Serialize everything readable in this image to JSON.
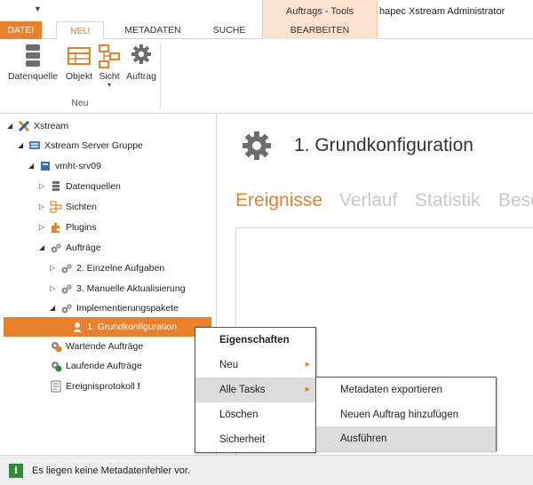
{
  "window": {
    "context_tab_group": "Auftrags - Tools",
    "title": "hapec Xstream Administrator"
  },
  "tabs": {
    "datei": "DATEI",
    "neu": "NEU",
    "metadaten": "METADATEN",
    "suche": "SUCHE",
    "bearbeiten": "BEARBEITEN"
  },
  "ribbon": {
    "buttons": {
      "datenquelle": "Datenquelle",
      "objekt": "Objekt",
      "sicht": "Sicht",
      "auftrag": "Auftrag"
    },
    "group_label": "Neu"
  },
  "tree": {
    "xstream": "Xstream",
    "server_gruppe": "Xstream Server Gruppe",
    "server": "vmht-srv09",
    "datenquellen": "Datenquellen",
    "sichten": "Sichten",
    "plugins": "Plugins",
    "auftraege": "Aufträge",
    "einzelne_aufgaben": "2. Einzelne Aufgaben",
    "manuelle_aktualisierung": "3. Manuelle Aktualisierung",
    "implementierungspakete": "Implementierungspakete",
    "grundkonfiguration": "1. Grundkonfiguration",
    "wartende": "Wartende Aufträge",
    "laufende": "Laufende Aufträge",
    "ereignisprotokoll": "Ereignisprotokoll",
    "ereignisprotokoll_flag": "!"
  },
  "content": {
    "title": "1. Grundkonfiguration",
    "tabs": [
      "Ereignisse",
      "Verlauf",
      "Statistik",
      "Bese"
    ]
  },
  "context_menu": {
    "items": [
      "Eigenschaften",
      "Neu",
      "Alle Tasks",
      "Löschen",
      "Sicherheit"
    ]
  },
  "submenu": {
    "items": [
      "Metadaten exportieren",
      "Neuen Auftrag hinzufügen",
      "Ausführen"
    ]
  },
  "status": {
    "icon": "i",
    "text": "Es liegen keine Metadatenfehler vor."
  },
  "colors": {
    "accent": "#e8812a",
    "context_tab": "#fbe3cf",
    "status_icon": "#2e8b3a"
  }
}
